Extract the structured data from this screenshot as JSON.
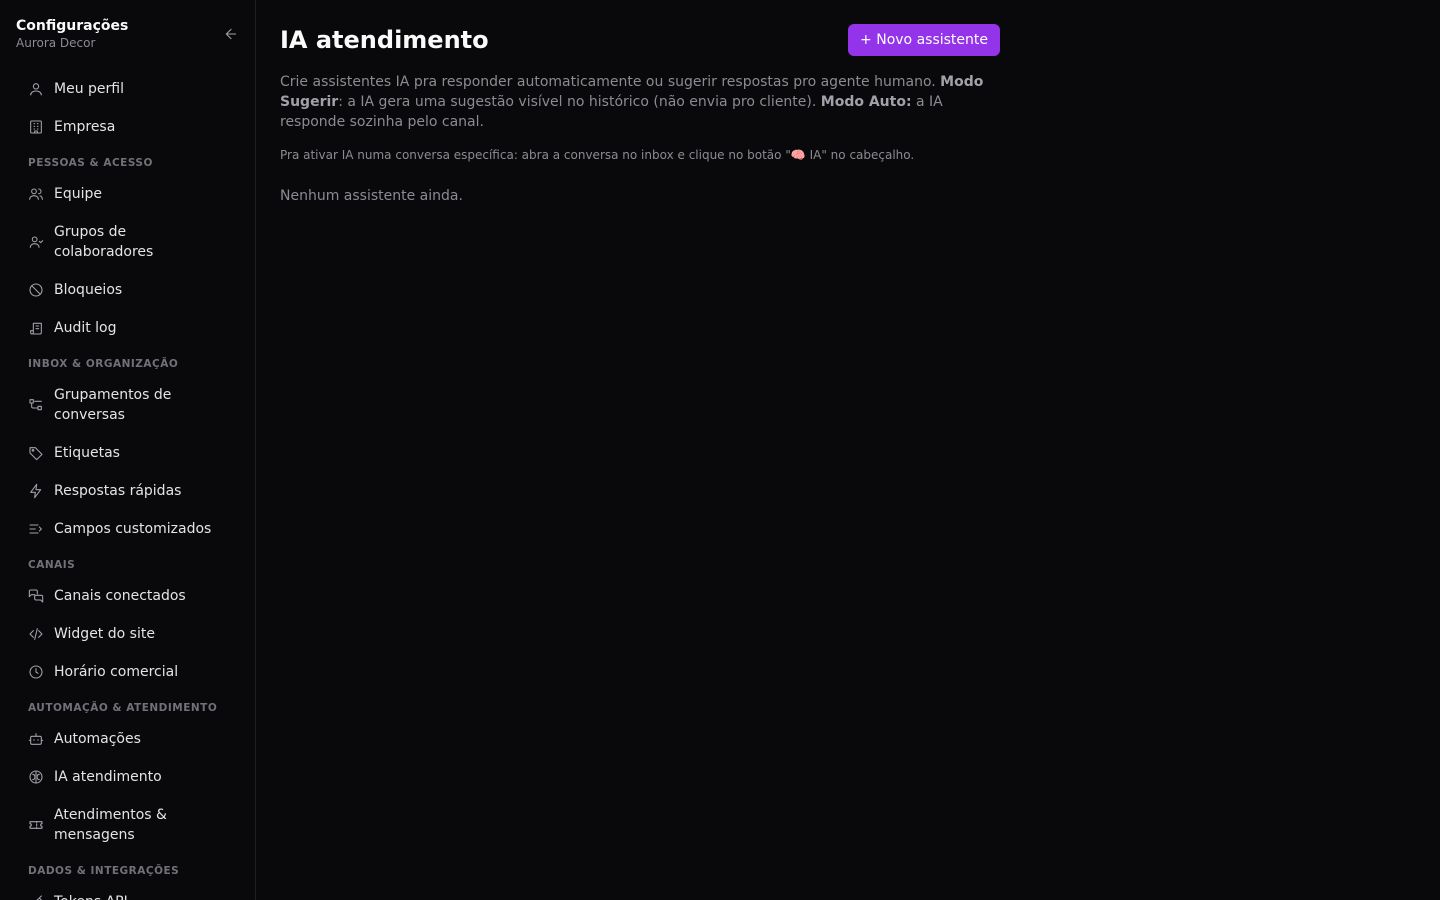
{
  "sidebar": {
    "title": "Configurações",
    "subtitle": "Aurora Decor",
    "items_top": [
      {
        "label": "Meu perfil",
        "icon": "user-icon"
      },
      {
        "label": "Empresa",
        "icon": "building-icon"
      }
    ],
    "sections": [
      {
        "label": "PESSOAS & ACESSO",
        "items": [
          {
            "label": "Equipe",
            "icon": "users-icon"
          },
          {
            "label": "Grupos de colaboradores",
            "icon": "user-group-icon"
          },
          {
            "label": "Bloqueios",
            "icon": "ban-icon"
          },
          {
            "label": "Audit log",
            "icon": "scroll-icon"
          }
        ]
      },
      {
        "label": "INBOX & ORGANIZAÇÃO",
        "items": [
          {
            "label": "Grupamentos de conversas",
            "icon": "workflow-icon"
          },
          {
            "label": "Etiquetas",
            "icon": "tag-icon"
          },
          {
            "label": "Respostas rápidas",
            "icon": "zap-icon"
          },
          {
            "label": "Campos customizados",
            "icon": "list-icon"
          }
        ]
      },
      {
        "label": "CANAIS",
        "items": [
          {
            "label": "Canais conectados",
            "icon": "messages-icon"
          },
          {
            "label": "Widget do site",
            "icon": "code-icon"
          },
          {
            "label": "Horário comercial",
            "icon": "clock-icon"
          }
        ]
      },
      {
        "label": "AUTOMAÇÃO & ATENDIMENTO",
        "items": [
          {
            "label": "Automações",
            "icon": "bot-icon"
          },
          {
            "label": "IA atendimento",
            "icon": "brain-icon"
          },
          {
            "label": "Atendimentos & mensagens",
            "icon": "ticket-icon"
          }
        ]
      },
      {
        "label": "DADOS & INTEGRAÇÕES",
        "items": [
          {
            "label": "Tokens API",
            "icon": "key-icon"
          }
        ]
      }
    ]
  },
  "main": {
    "title": "IA atendimento",
    "new_button": "+ Novo assistente",
    "desc_1": "Crie assistentes IA pra responder automaticamente ou sugerir respostas pro agente humano. ",
    "desc_b1": "Modo Sugerir",
    "desc_2": ": a IA gera uma sugestão visível no histórico (não envia pro cliente). ",
    "desc_b2": "Modo Auto:",
    "desc_3": " a IA responde sozinha pelo canal.",
    "hint": "Pra ativar IA numa conversa específica: abra a conversa no inbox e clique no botão \"🧠 IA\" no cabeçalho.",
    "empty": "Nenhum assistente ainda."
  },
  "colors": {
    "background": "#09090b",
    "accent": "#9333ea",
    "muted_text": "#8b8b93"
  }
}
